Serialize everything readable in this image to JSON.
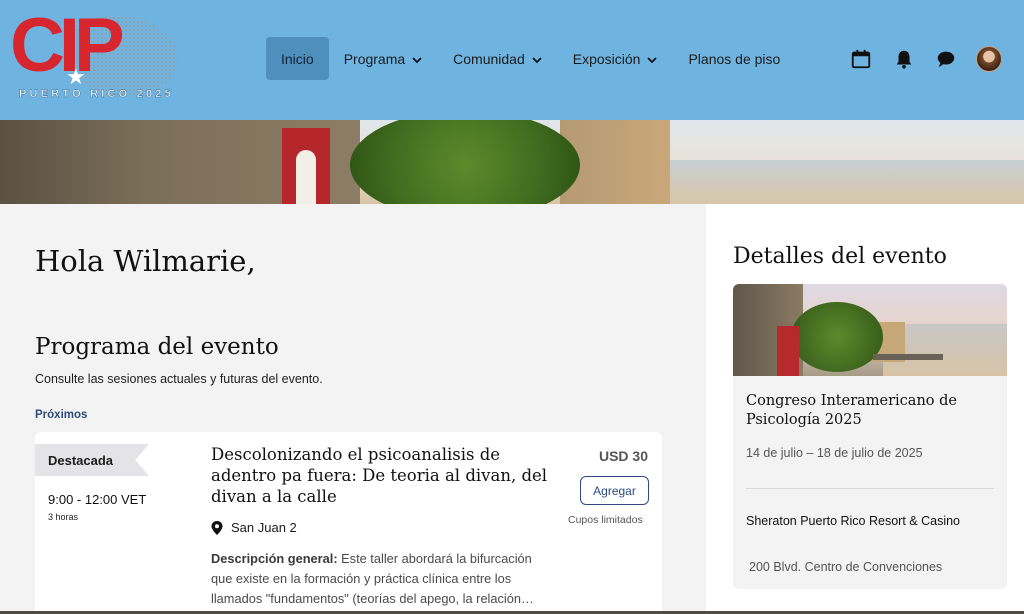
{
  "logo": {
    "letters": "CIP",
    "subtitle": "PUERTO RICO 2025"
  },
  "nav": {
    "items": [
      {
        "label": "Inicio",
        "active": true,
        "dropdown": false
      },
      {
        "label": "Programa",
        "active": false,
        "dropdown": true
      },
      {
        "label": "Comunidad",
        "active": false,
        "dropdown": true
      },
      {
        "label": "Exposición",
        "active": false,
        "dropdown": true
      },
      {
        "label": "Planos de piso",
        "active": false,
        "dropdown": false
      }
    ],
    "icons": [
      "calendar-icon",
      "bell-icon",
      "chat-icon",
      "avatar"
    ]
  },
  "main": {
    "greeting": "Hola Wilmarie,",
    "section_title": "Programa del evento",
    "section_subtitle": "Consulte las sesiones actuales y futuras del evento.",
    "upcoming_label": "Próximos",
    "session": {
      "tag": "Destacada",
      "time": "9:00 - 12:00 VET",
      "duration": "3 horas",
      "title": "Descolonizando el psicoanalisis de adentro pa fuera: De teoria al divan, del divan a la calle",
      "location": "San Juan 2",
      "description_label": "Descripción general:",
      "description": " Este taller abordará la bifurcación que existe en la formación y práctica clínica entre los llamados \"fundamentos\" (teorías del apego, la relación…",
      "price": "USD 30",
      "add_label": "Agregar",
      "availability": "Cupos limitados"
    }
  },
  "sidebar": {
    "title": "Detalles del evento",
    "event_name": "Congreso Interamericano de Psicología 2025",
    "dates": "14 de julio – 18 de julio de 2025",
    "venue": "Sheraton Puerto Rico Resort & Casino",
    "address": "200 Blvd. Centro de Convenciones"
  },
  "colors": {
    "header_bg": "#6fb4e1",
    "nav_active_bg": "#4f8fbd",
    "logo_red": "#d8262f",
    "accent_blue": "#2d4a86"
  }
}
